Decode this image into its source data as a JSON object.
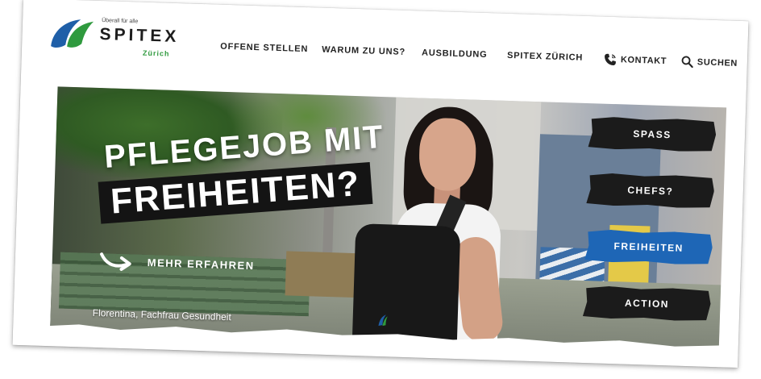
{
  "logo": {
    "tagline": "Überall für alle",
    "name": "SPITEX",
    "city": "Zürich",
    "colors": {
      "blue": "#1f5fa8",
      "green": "#2f9a3e"
    }
  },
  "nav": {
    "items": [
      {
        "label": "OFFENE STELLEN"
      },
      {
        "label": "WARUM ZU UNS?"
      },
      {
        "label": "AUSBILDUNG"
      },
      {
        "label": "SPITEX ZÜRICH"
      }
    ],
    "contact_label": "KONTAKT",
    "contact_icon": "phone-icon",
    "search_label": "SUCHEN",
    "search_icon": "search-icon"
  },
  "hero": {
    "title_line1": "PFLEGEJOB MIT",
    "title_line2": "FREIHEITEN?",
    "cta_label": "MEHR ERFAHREN",
    "cta_icon": "arrow-right-icon",
    "caption": "Florentina, Fachfrau Gesundheit",
    "tabs": [
      {
        "label": "SPASS",
        "active": false
      },
      {
        "label": "CHEFS?",
        "active": false
      },
      {
        "label": "FREIHEITEN",
        "active": true
      },
      {
        "label": "ACTION",
        "active": false
      }
    ],
    "colors": {
      "active_tab": "#1e66b6",
      "tab": "#1b1b1b"
    }
  }
}
